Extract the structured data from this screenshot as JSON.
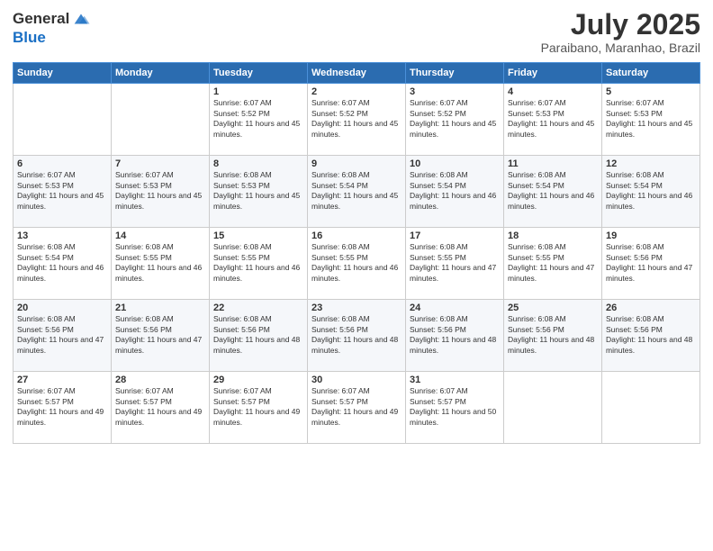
{
  "header": {
    "logo_line1": "General",
    "logo_line2": "Blue",
    "month": "July 2025",
    "location": "Paraibano, Maranhao, Brazil"
  },
  "days_of_week": [
    "Sunday",
    "Monday",
    "Tuesday",
    "Wednesday",
    "Thursday",
    "Friday",
    "Saturday"
  ],
  "weeks": [
    [
      {
        "day": "",
        "info": ""
      },
      {
        "day": "",
        "info": ""
      },
      {
        "day": "1",
        "info": "Sunrise: 6:07 AM\nSunset: 5:52 PM\nDaylight: 11 hours and 45 minutes."
      },
      {
        "day": "2",
        "info": "Sunrise: 6:07 AM\nSunset: 5:52 PM\nDaylight: 11 hours and 45 minutes."
      },
      {
        "day": "3",
        "info": "Sunrise: 6:07 AM\nSunset: 5:52 PM\nDaylight: 11 hours and 45 minutes."
      },
      {
        "day": "4",
        "info": "Sunrise: 6:07 AM\nSunset: 5:53 PM\nDaylight: 11 hours and 45 minutes."
      },
      {
        "day": "5",
        "info": "Sunrise: 6:07 AM\nSunset: 5:53 PM\nDaylight: 11 hours and 45 minutes."
      }
    ],
    [
      {
        "day": "6",
        "info": "Sunrise: 6:07 AM\nSunset: 5:53 PM\nDaylight: 11 hours and 45 minutes."
      },
      {
        "day": "7",
        "info": "Sunrise: 6:07 AM\nSunset: 5:53 PM\nDaylight: 11 hours and 45 minutes."
      },
      {
        "day": "8",
        "info": "Sunrise: 6:08 AM\nSunset: 5:53 PM\nDaylight: 11 hours and 45 minutes."
      },
      {
        "day": "9",
        "info": "Sunrise: 6:08 AM\nSunset: 5:54 PM\nDaylight: 11 hours and 45 minutes."
      },
      {
        "day": "10",
        "info": "Sunrise: 6:08 AM\nSunset: 5:54 PM\nDaylight: 11 hours and 46 minutes."
      },
      {
        "day": "11",
        "info": "Sunrise: 6:08 AM\nSunset: 5:54 PM\nDaylight: 11 hours and 46 minutes."
      },
      {
        "day": "12",
        "info": "Sunrise: 6:08 AM\nSunset: 5:54 PM\nDaylight: 11 hours and 46 minutes."
      }
    ],
    [
      {
        "day": "13",
        "info": "Sunrise: 6:08 AM\nSunset: 5:54 PM\nDaylight: 11 hours and 46 minutes."
      },
      {
        "day": "14",
        "info": "Sunrise: 6:08 AM\nSunset: 5:55 PM\nDaylight: 11 hours and 46 minutes."
      },
      {
        "day": "15",
        "info": "Sunrise: 6:08 AM\nSunset: 5:55 PM\nDaylight: 11 hours and 46 minutes."
      },
      {
        "day": "16",
        "info": "Sunrise: 6:08 AM\nSunset: 5:55 PM\nDaylight: 11 hours and 46 minutes."
      },
      {
        "day": "17",
        "info": "Sunrise: 6:08 AM\nSunset: 5:55 PM\nDaylight: 11 hours and 47 minutes."
      },
      {
        "day": "18",
        "info": "Sunrise: 6:08 AM\nSunset: 5:55 PM\nDaylight: 11 hours and 47 minutes."
      },
      {
        "day": "19",
        "info": "Sunrise: 6:08 AM\nSunset: 5:56 PM\nDaylight: 11 hours and 47 minutes."
      }
    ],
    [
      {
        "day": "20",
        "info": "Sunrise: 6:08 AM\nSunset: 5:56 PM\nDaylight: 11 hours and 47 minutes."
      },
      {
        "day": "21",
        "info": "Sunrise: 6:08 AM\nSunset: 5:56 PM\nDaylight: 11 hours and 47 minutes."
      },
      {
        "day": "22",
        "info": "Sunrise: 6:08 AM\nSunset: 5:56 PM\nDaylight: 11 hours and 48 minutes."
      },
      {
        "day": "23",
        "info": "Sunrise: 6:08 AM\nSunset: 5:56 PM\nDaylight: 11 hours and 48 minutes."
      },
      {
        "day": "24",
        "info": "Sunrise: 6:08 AM\nSunset: 5:56 PM\nDaylight: 11 hours and 48 minutes."
      },
      {
        "day": "25",
        "info": "Sunrise: 6:08 AM\nSunset: 5:56 PM\nDaylight: 11 hours and 48 minutes."
      },
      {
        "day": "26",
        "info": "Sunrise: 6:08 AM\nSunset: 5:56 PM\nDaylight: 11 hours and 48 minutes."
      }
    ],
    [
      {
        "day": "27",
        "info": "Sunrise: 6:07 AM\nSunset: 5:57 PM\nDaylight: 11 hours and 49 minutes."
      },
      {
        "day": "28",
        "info": "Sunrise: 6:07 AM\nSunset: 5:57 PM\nDaylight: 11 hours and 49 minutes."
      },
      {
        "day": "29",
        "info": "Sunrise: 6:07 AM\nSunset: 5:57 PM\nDaylight: 11 hours and 49 minutes."
      },
      {
        "day": "30",
        "info": "Sunrise: 6:07 AM\nSunset: 5:57 PM\nDaylight: 11 hours and 49 minutes."
      },
      {
        "day": "31",
        "info": "Sunrise: 6:07 AM\nSunset: 5:57 PM\nDaylight: 11 hours and 50 minutes."
      },
      {
        "day": "",
        "info": ""
      },
      {
        "day": "",
        "info": ""
      }
    ]
  ]
}
